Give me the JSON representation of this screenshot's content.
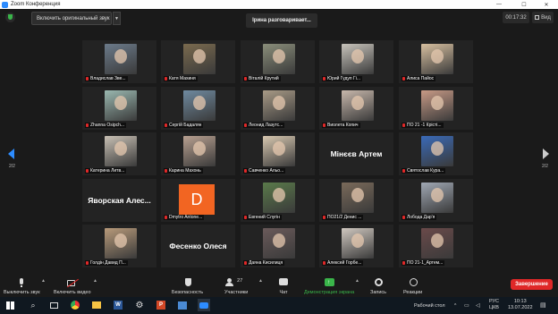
{
  "window": {
    "title": "Zoom Конференция"
  },
  "topbar": {
    "audio_label": "Включить оригинальный звук",
    "speaker": "Ірина разговаривает...",
    "timer": "00:17:32",
    "view_label": "Вид"
  },
  "pagination": {
    "left": "2/2",
    "right": "2/2"
  },
  "participants": [
    {
      "name": "Владислав Зве...",
      "photo": "#6b7a8a"
    },
    {
      "name": "Катя Махиня",
      "photo": "#7a6a4e"
    },
    {
      "name": "Віталій Крутий",
      "photo": "#8a8e7a"
    },
    {
      "name": "Юрий Гудуп Гі...",
      "photo": "#c8c4bc"
    },
    {
      "name": "Алиса Пайос",
      "photo": "#d8c0a0"
    },
    {
      "name": "Zhanna Osipch...",
      "photo": "#9ab8b0"
    },
    {
      "name": "Сергій Бадалян",
      "photo": "#6f8aa0"
    },
    {
      "name": "Леонид Лазутс...",
      "photo": "#a89a86"
    },
    {
      "name": "Виолета Копич",
      "photo": "#c8b8ac"
    },
    {
      "name": "ПО 21 -1 Крісті...",
      "photo": "#c89a86"
    },
    {
      "name": "Катерина Литв...",
      "photo": "#c8c0b4"
    },
    {
      "name": "Карина Махонь",
      "photo": "#b8a090"
    },
    {
      "name": "Савченко Альо...",
      "photo": "#d8c8b0"
    },
    {
      "name": "",
      "big": "Мінєєв Артем"
    },
    {
      "name": "Святослав Кура...",
      "photo": "#3a6ab8"
    },
    {
      "name": "",
      "big": "Яворская  Алес..."
    },
    {
      "name": "Dmytro Antone...",
      "avatar": "D"
    },
    {
      "name": "Евгений Слугін",
      "photo": "#5a7a4a"
    },
    {
      "name": "ПО21/2 Денис ...",
      "photo": "#7a6a5a"
    },
    {
      "name": "Лобода Дар'я",
      "photo": "#a0a8b4"
    },
    {
      "name": "Голдін Давид П...",
      "photo": "#b89a7a"
    },
    {
      "name": "",
      "big": "Фесенко Олеся"
    },
    {
      "name": "Даяна Кисилиця",
      "photo": "#6a5a5a"
    },
    {
      "name": "Алексей Горбе...",
      "photo": "#d0c8c0"
    },
    {
      "name": "ПО 21-1_Артем...",
      "photo": "#6a4a4a"
    }
  ],
  "toolbar": {
    "mute": "Выключить звук",
    "video": "Включить видео",
    "security": "Безопасность",
    "participants": "Участники",
    "participants_count": "27",
    "chat": "Чат",
    "share": "Демонстрация экрана",
    "record": "Запись",
    "reactions": "Реакции",
    "end": "Завершение"
  },
  "taskbar": {
    "desktop": "Рабочий стол",
    "lang1": "РУС",
    "lang2": "ЦКВ",
    "time": "10:13",
    "date": "13.07.2022"
  },
  "colors": {
    "accent": "#2d8cff",
    "end": "#e02828",
    "share": "#3ab54a"
  }
}
